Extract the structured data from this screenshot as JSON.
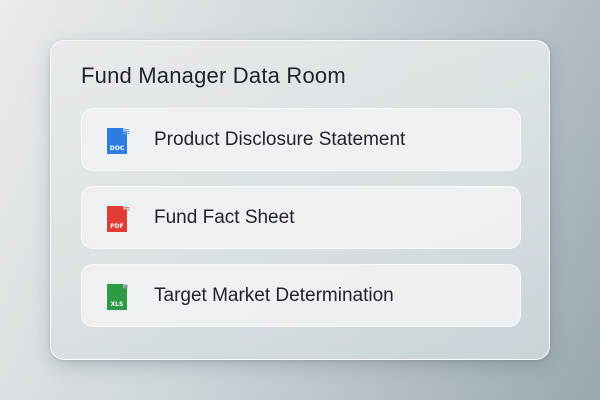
{
  "data_room": {
    "title": "Fund Manager Data Room",
    "documents": [
      {
        "label": "Product Disclosure Statement",
        "file_type": "DOC",
        "icon": "doc-file-icon",
        "color": "#2b7de0"
      },
      {
        "label": "Fund Fact Sheet",
        "file_type": "PDF",
        "icon": "pdf-file-icon",
        "color": "#e23b36"
      },
      {
        "label": "Target Market Determination",
        "file_type": "XLS",
        "icon": "xls-file-icon",
        "color": "#2f9a44"
      }
    ]
  }
}
